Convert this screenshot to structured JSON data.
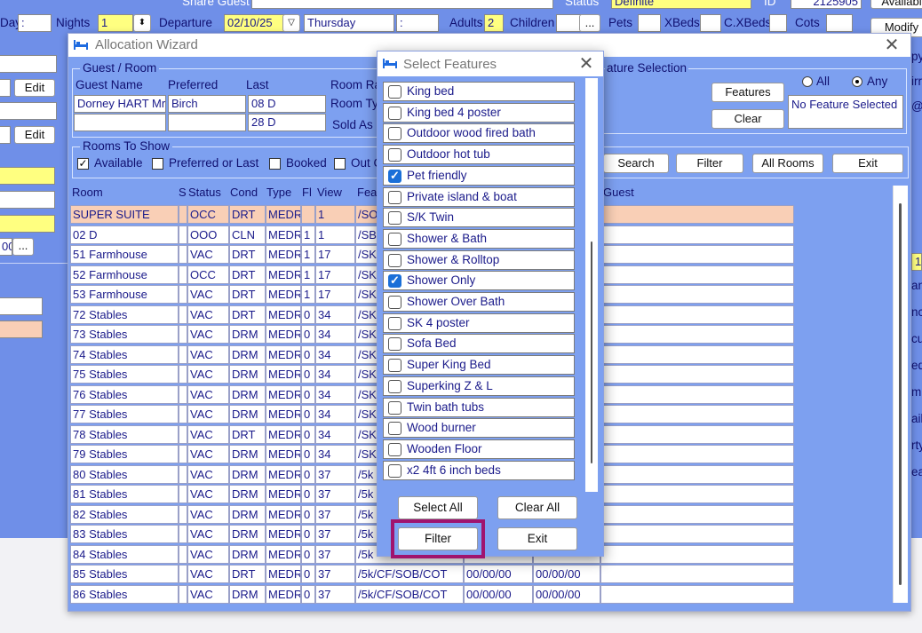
{
  "topbar": {
    "share_guest_label": "Share Guest",
    "status_label": "Status",
    "status_value": "Definite",
    "id_label": "ID",
    "id_value": "2125905",
    "availability_button": "Availabi",
    "day_label": "Day",
    "colon1": ":",
    "nights_label": "Nights",
    "nights_value": "1",
    "departure_label": "Departure",
    "departure_value": "02/10/25",
    "departure_day": "Thursday",
    "colon2": ":",
    "adults_label": "Adults",
    "adults_value": "2",
    "children_label": "Children",
    "ellipsis": "...",
    "pets_label": "Pets",
    "xbeds_label": "XBeds",
    "cxbeds_label": "C.XBeds",
    "cots_label": "Cots",
    "modify_button": "Modify"
  },
  "left_panel": {
    "edit1": "Edit",
    "edit2": "Edit",
    "partial_value": "00",
    "ellipsis": "..."
  },
  "right_partial": {
    "items": [
      "py",
      "irr",
      "@h",
      "1",
      "an",
      "nc",
      "cu",
      "ed",
      "m",
      "ail",
      "rty",
      "eat"
    ]
  },
  "wizard": {
    "title": "Allocation Wizard",
    "guest_room_group": "Guest / Room",
    "guest_name_label": "Guest Name",
    "preferred_label": "Preferred",
    "last_label": "Last",
    "guest_name_value": "Dorney HART Mr",
    "preferred_value": "Birch",
    "last_value1": "08 D",
    "last_value2": "28 D",
    "room_rate_label": "Room Ra",
    "room_type_label": "Room Ty",
    "sold_as_label": "Sold As",
    "feature_selection_group": "ature Selection",
    "features_button": "Features",
    "clear_button": "Clear",
    "all_label": "All",
    "any_label": "Any",
    "no_feature_text": "No Feature Selected",
    "rooms_to_show_group": "Rooms To Show",
    "available_label": "Available",
    "preferred_or_last_label": "Preferred or Last",
    "booked_label": "Booked",
    "out_label": "Out C",
    "search_button": "Search",
    "filter_button": "Filter",
    "all_rooms_button": "All Rooms",
    "exit_button": "Exit"
  },
  "grid": {
    "headers": [
      "Room",
      "S",
      "Status",
      "Cond",
      "Type",
      "Fl",
      "View",
      "Fea",
      "Guest"
    ],
    "rows": [
      [
        "SUPER SUITE",
        "",
        "OCC",
        "DRT",
        "MEDR",
        "",
        "1",
        "/SO",
        "",
        ""
      ],
      [
        "02 D",
        "",
        "OOO",
        "CLN",
        "MEDR",
        "1",
        "1",
        "/SB",
        "",
        ""
      ],
      [
        "51 Farmhouse",
        "",
        "VAC",
        "DRT",
        "MEDR",
        "1",
        "17",
        "/SK",
        "",
        ""
      ],
      [
        "52 Farmhouse",
        "",
        "OCC",
        "DRT",
        "MEDR",
        "1",
        "17",
        "/SK",
        "",
        ""
      ],
      [
        "53 Farmhouse",
        "",
        "VAC",
        "DRT",
        "MEDR",
        "1",
        "17",
        "/SK",
        "",
        ""
      ],
      [
        "72 Stables",
        "",
        "VAC",
        "DRT",
        "MEDR",
        "0",
        "34",
        "/SK",
        "",
        ""
      ],
      [
        "73 Stables",
        "",
        "VAC",
        "DRM",
        "MEDR",
        "0",
        "34",
        "/SK",
        "",
        ""
      ],
      [
        "74 Stables",
        "",
        "VAC",
        "DRM",
        "MEDR",
        "0",
        "34",
        "/SK",
        "",
        ""
      ],
      [
        "75 Stables",
        "",
        "VAC",
        "DRM",
        "MEDR",
        "0",
        "34",
        "/SK",
        "",
        ""
      ],
      [
        "76 Stables",
        "",
        "VAC",
        "DRM",
        "MEDR",
        "0",
        "34",
        "/SK",
        "",
        ""
      ],
      [
        "77 Stables",
        "",
        "VAC",
        "DRM",
        "MEDR",
        "0",
        "34",
        "/SK",
        "",
        ""
      ],
      [
        "78 Stables",
        "",
        "VAC",
        "DRT",
        "MEDR",
        "0",
        "34",
        "/SK",
        "",
        ""
      ],
      [
        "79 Stables",
        "",
        "VAC",
        "DRM",
        "MEDR",
        "0",
        "34",
        "/SK",
        "",
        ""
      ],
      [
        "80 Stables",
        "",
        "VAC",
        "DRM",
        "MEDR",
        "0",
        "37",
        "/5k",
        "",
        ""
      ],
      [
        "81 Stables",
        "",
        "VAC",
        "DRM",
        "MEDR",
        "0",
        "37",
        "/5k",
        "",
        ""
      ],
      [
        "82 Stables",
        "",
        "VAC",
        "DRM",
        "MEDR",
        "0",
        "37",
        "/5k",
        "",
        ""
      ],
      [
        "83 Stables",
        "",
        "VAC",
        "DRM",
        "MEDR",
        "0",
        "37",
        "/5k",
        "",
        ""
      ],
      [
        "84 Stables",
        "",
        "VAC",
        "DRM",
        "MEDR",
        "0",
        "37",
        "/5k",
        "",
        ""
      ],
      [
        "85 Stables",
        "",
        "VAC",
        "DRT",
        "MEDR",
        "0",
        "37",
        "/5k/CF/SOB/COT",
        "00/00/00",
        "00/00/00"
      ],
      [
        "86 Stables",
        "",
        "VAC",
        "DRM",
        "MEDR",
        "0",
        "37",
        "/5k/CF/SOB/COT",
        "00/00/00",
        "00/00/00"
      ]
    ]
  },
  "features_dialog": {
    "title": "Select Features",
    "items": [
      {
        "label": "King bed",
        "checked": false
      },
      {
        "label": "King bed 4 poster",
        "checked": false
      },
      {
        "label": "Outdoor wood fired bath",
        "checked": false
      },
      {
        "label": "Outdoor hot tub",
        "checked": false
      },
      {
        "label": "Pet friendly",
        "checked": true
      },
      {
        "label": "Private island & boat",
        "checked": false
      },
      {
        "label": "S/K Twin",
        "checked": false
      },
      {
        "label": "Shower & Bath",
        "checked": false
      },
      {
        "label": "Shower & Rolltop",
        "checked": false
      },
      {
        "label": "Shower Only",
        "checked": true
      },
      {
        "label": "Shower Over Bath",
        "checked": false
      },
      {
        "label": "SK 4 poster",
        "checked": false
      },
      {
        "label": "Sofa Bed",
        "checked": false
      },
      {
        "label": "Super King Bed",
        "checked": false
      },
      {
        "label": "Superking Z & L",
        "checked": false
      },
      {
        "label": "Twin bath tubs",
        "checked": false
      },
      {
        "label": "Wood burner",
        "checked": false
      },
      {
        "label": "Wooden Floor",
        "checked": false
      },
      {
        "label": "x2 4ft 6 inch beds",
        "checked": false
      }
    ],
    "select_all_button": "Select All",
    "clear_all_button": "Clear All",
    "filter_button": "Filter",
    "exit_button": "Exit"
  },
  "colors": {
    "window_bg": "#7da0f0",
    "highlight_row": "#f9cfb6",
    "yellow_field": "#ffff80",
    "focus_box": "#a0146e",
    "checkbox_blue": "#1a6fd8"
  }
}
